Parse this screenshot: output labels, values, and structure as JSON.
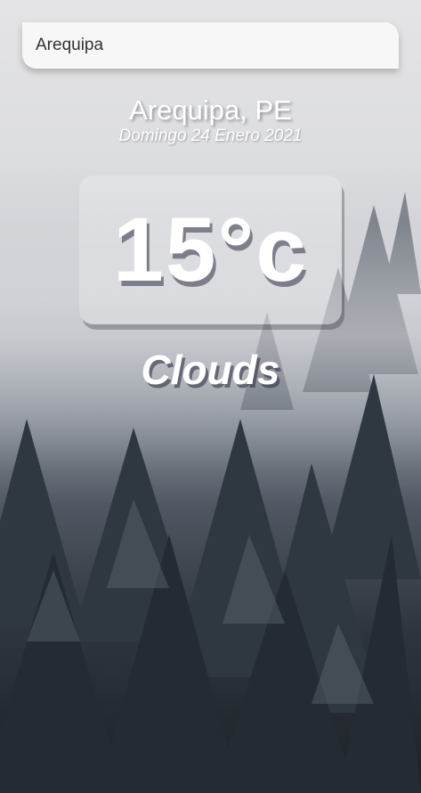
{
  "search": {
    "value": "Arequipa",
    "placeholder": ""
  },
  "location": {
    "city": "Arequipa, PE",
    "date": "Domingo 24 Enero 2021"
  },
  "current": {
    "temperature": "15°c",
    "condition": "Clouds"
  },
  "colors": {
    "text": "#ffffff",
    "fog": "#e4e4e6",
    "forest": "#1d2228"
  },
  "background": {
    "scene": "misty-forest"
  }
}
